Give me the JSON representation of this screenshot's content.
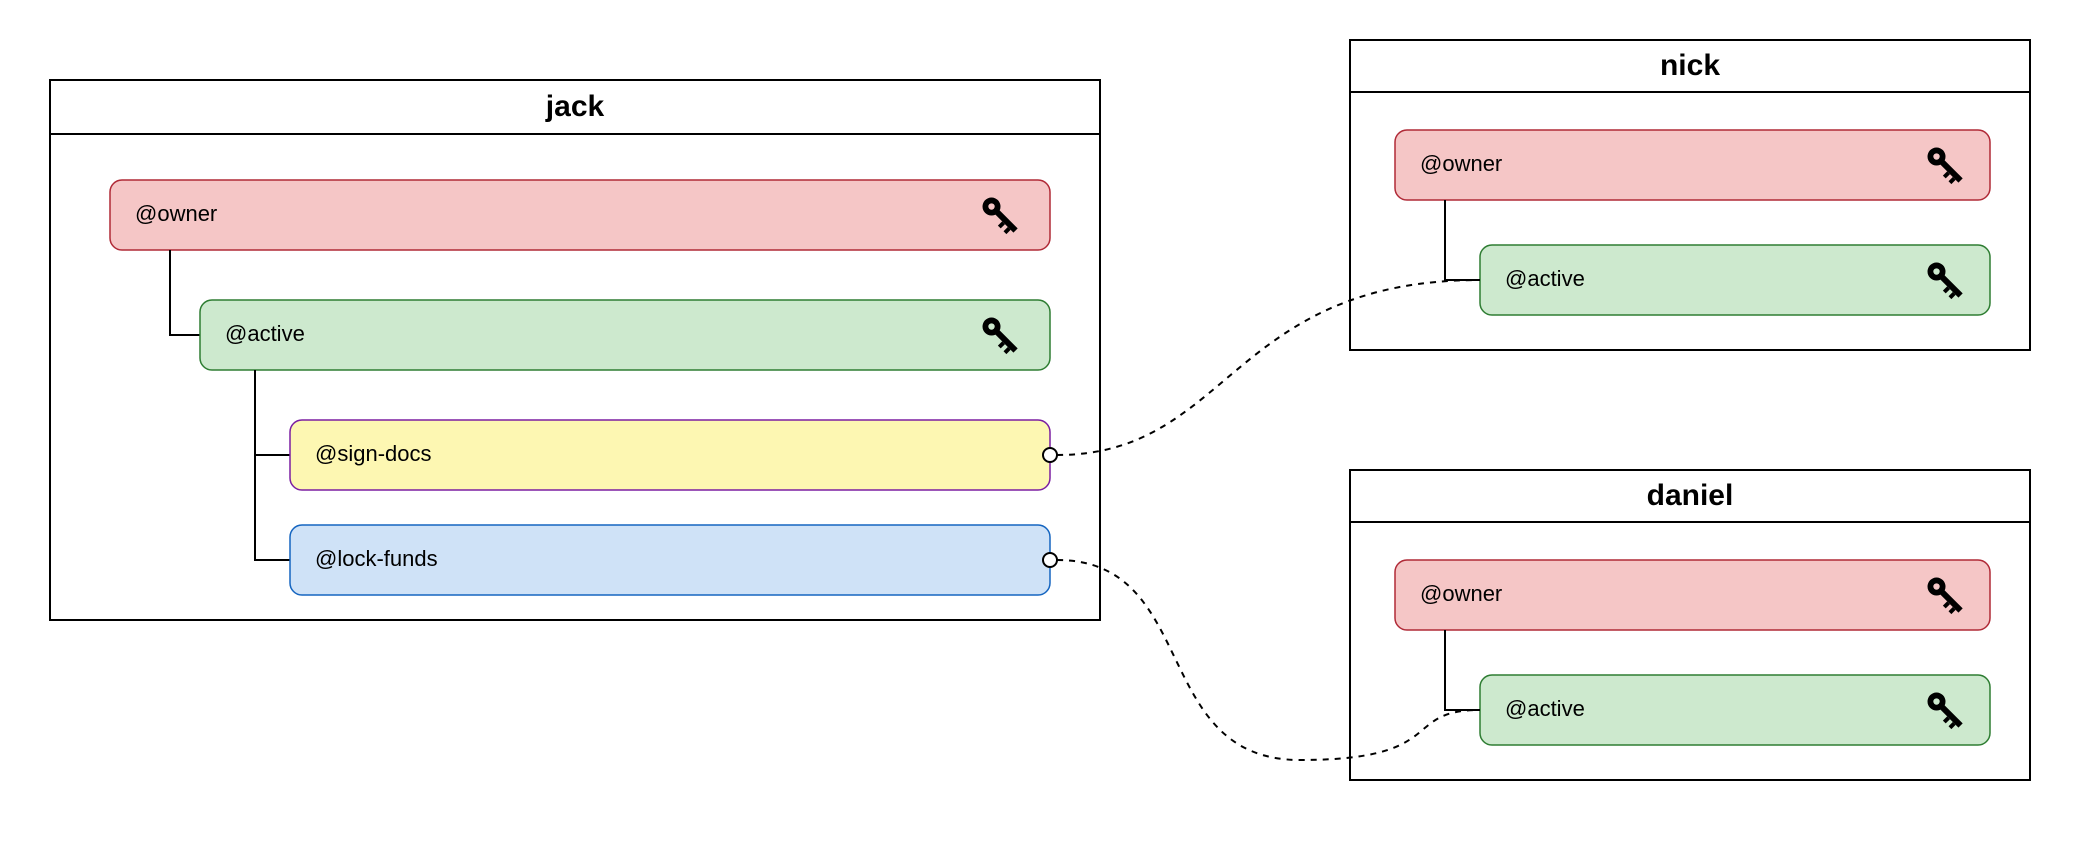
{
  "accounts": {
    "jack": {
      "title": "jack",
      "perms": {
        "owner": {
          "label": "@owner",
          "color_fill": "#f5c6c6",
          "color_stroke": "#b02a37",
          "has_key": true
        },
        "active": {
          "label": "@active",
          "color_fill": "#cde9ce",
          "color_stroke": "#2e7d32",
          "has_key": true
        },
        "sign": {
          "label": "@sign-docs",
          "color_fill": "#fdf7b2",
          "color_stroke": "#7b1fa2",
          "has_key": false
        },
        "lock": {
          "label": "@lock-funds",
          "color_fill": "#cfe2f7",
          "color_stroke": "#1565c0",
          "has_key": false
        }
      }
    },
    "nick": {
      "title": "nick",
      "perms": {
        "owner": {
          "label": "@owner",
          "color_fill": "#f5c6c6",
          "color_stroke": "#b02a37",
          "has_key": true
        },
        "active": {
          "label": "@active",
          "color_fill": "#cde9ce",
          "color_stroke": "#2e7d32",
          "has_key": true
        }
      }
    },
    "daniel": {
      "title": "daniel",
      "perms": {
        "owner": {
          "label": "@owner",
          "color_fill": "#f5c6c6",
          "color_stroke": "#b02a37",
          "has_key": true
        },
        "active": {
          "label": "@active",
          "color_fill": "#cde9ce",
          "color_stroke": "#2e7d32",
          "has_key": true
        }
      }
    }
  }
}
